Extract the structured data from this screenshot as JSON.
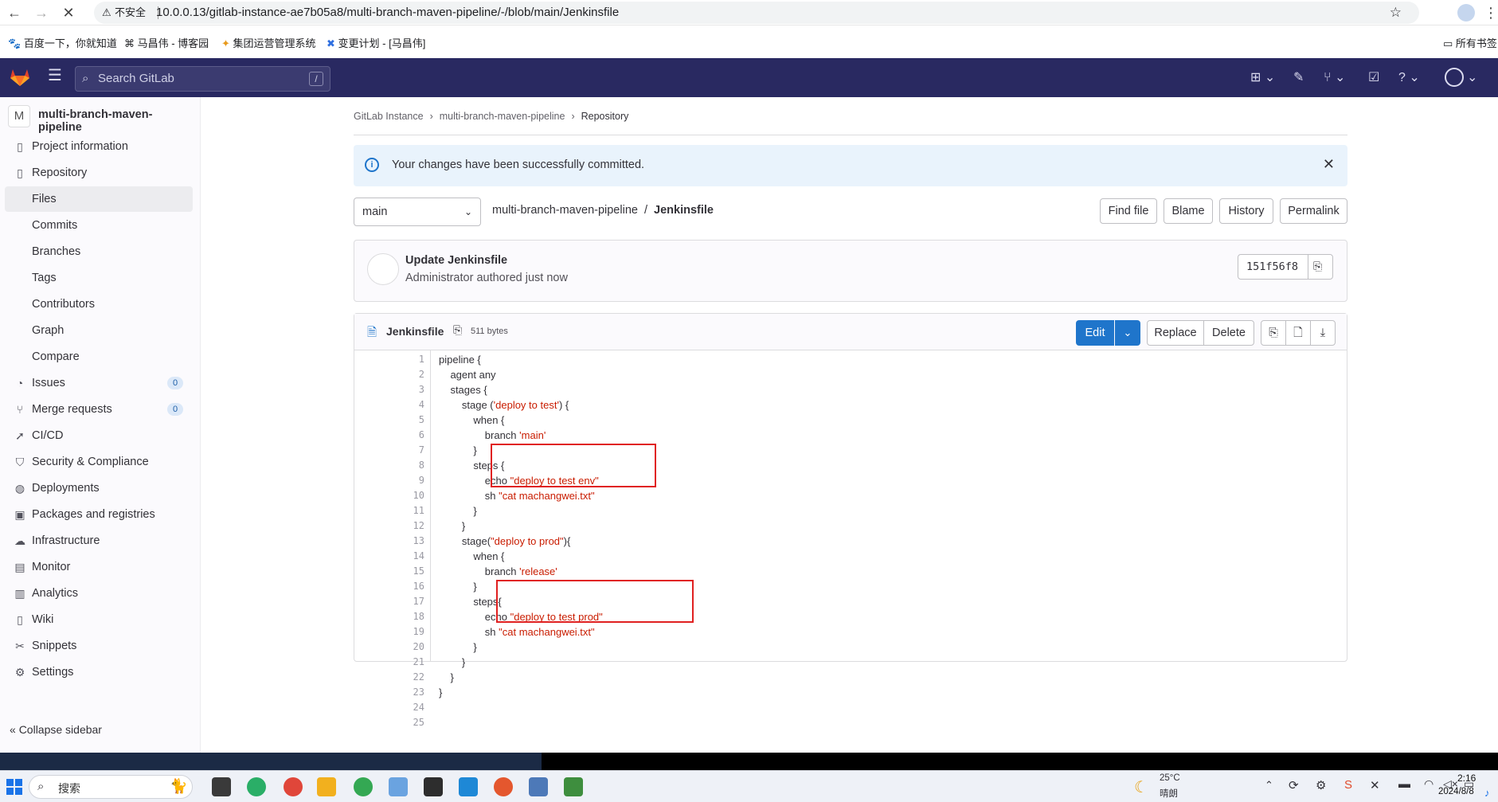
{
  "browser": {
    "not_secure": "不安全",
    "url": "10.0.0.13/gitlab-instance-ae7b05a8/multi-branch-maven-pipeline/-/blob/main/Jenkinsfile",
    "bookmarks": [
      "百度一下，你就知道",
      "马昌伟 - 博客园",
      "集团运营管理系统",
      "变更计划 - [马昌伟]"
    ],
    "all_bookmarks": "所有书签"
  },
  "header": {
    "search_placeholder": "Search GitLab",
    "search_shortcut": "/"
  },
  "sidebar": {
    "project_initial": "M",
    "project_name": "multi-branch-maven-pipeline",
    "items": [
      {
        "label": "Project information",
        "icon": "info-doc-icon"
      },
      {
        "label": "Repository",
        "icon": "book-icon"
      },
      {
        "label": "Files"
      },
      {
        "label": "Commits"
      },
      {
        "label": "Branches"
      },
      {
        "label": "Tags"
      },
      {
        "label": "Contributors"
      },
      {
        "label": "Graph"
      },
      {
        "label": "Compare"
      },
      {
        "label": "Issues",
        "icon": "issues-icon",
        "badge": "0"
      },
      {
        "label": "Merge requests",
        "icon": "merge-request-icon",
        "badge": "0"
      },
      {
        "label": "CI/CD",
        "icon": "rocket-icon"
      },
      {
        "label": "Security & Compliance",
        "icon": "shield-icon"
      },
      {
        "label": "Deployments",
        "icon": "deployments-icon"
      },
      {
        "label": "Packages and registries",
        "icon": "package-icon"
      },
      {
        "label": "Infrastructure",
        "icon": "cloud-icon"
      },
      {
        "label": "Monitor",
        "icon": "monitor-icon"
      },
      {
        "label": "Analytics",
        "icon": "chart-icon"
      },
      {
        "label": "Wiki",
        "icon": "book-icon"
      },
      {
        "label": "Snippets",
        "icon": "snippet-icon"
      },
      {
        "label": "Settings",
        "icon": "gear-icon"
      }
    ],
    "collapse": "Collapse sidebar"
  },
  "breadcrumb": [
    "GitLab Instance",
    "multi-branch-maven-pipeline",
    "Repository"
  ],
  "alert": "Your changes have been successfully committed.",
  "file_nav": {
    "branch": "main",
    "path_project": "multi-branch-maven-pipeline",
    "separator": "/",
    "file": "Jenkinsfile",
    "buttons": [
      "Find file",
      "Blame",
      "History",
      "Permalink"
    ]
  },
  "commit": {
    "title": "Update Jenkinsfile",
    "author": "Administrator",
    "meta": "authored just now",
    "sha": "151f56f8"
  },
  "blob": {
    "name": "Jenkinsfile",
    "size": "511 bytes",
    "edit": "Edit",
    "replace": "Replace",
    "delete": "Delete",
    "lines": [
      [
        [
          "pipeline {",
          ""
        ]
      ],
      [
        [
          "    agent any",
          ""
        ]
      ],
      [
        [
          "    stages {",
          ""
        ]
      ],
      [
        [
          "        stage (",
          ""
        ],
        [
          "'deploy to test'",
          "s"
        ],
        [
          ") {",
          ""
        ]
      ],
      [
        [
          "            when {",
          ""
        ]
      ],
      [
        [
          "                branch ",
          ""
        ],
        [
          "'main'",
          "s"
        ]
      ],
      [
        [
          "            }",
          ""
        ]
      ],
      [
        [
          "            steps {",
          ""
        ]
      ],
      [
        [
          "                echo ",
          ""
        ],
        [
          "\"deploy to test env\"",
          "s"
        ]
      ],
      [
        [
          "                sh ",
          ""
        ],
        [
          "\"cat machangwei.txt\"",
          "s"
        ]
      ],
      [
        [
          "            }",
          ""
        ]
      ],
      [
        [
          "        }",
          ""
        ]
      ],
      [
        [
          "        stage(",
          ""
        ],
        [
          "\"deploy to prod\"",
          "s"
        ],
        [
          "){",
          ""
        ]
      ],
      [
        [
          "            when {",
          ""
        ]
      ],
      [
        [
          "                branch ",
          ""
        ],
        [
          "'release'",
          "s"
        ]
      ],
      [
        [
          "            }",
          ""
        ]
      ],
      [
        [
          "            steps{",
          ""
        ]
      ],
      [
        [
          "                echo ",
          ""
        ],
        [
          "\"deploy to test prod\"",
          "s"
        ]
      ],
      [
        [
          "                sh ",
          ""
        ],
        [
          "\"cat machangwei.txt\"",
          "s"
        ]
      ],
      [
        [
          "            }",
          ""
        ]
      ],
      [
        [
          "        }",
          ""
        ]
      ],
      [
        [
          "    }",
          ""
        ]
      ],
      [
        [
          "}",
          ""
        ]
      ],
      [
        [
          "",
          ""
        ]
      ],
      [
        [
          "",
          ""
        ]
      ]
    ]
  },
  "taskbar": {
    "search": "搜索",
    "weather_temp": "25°C",
    "weather_desc": "晴朗",
    "time": "2:16",
    "date": "2024/8/8"
  }
}
